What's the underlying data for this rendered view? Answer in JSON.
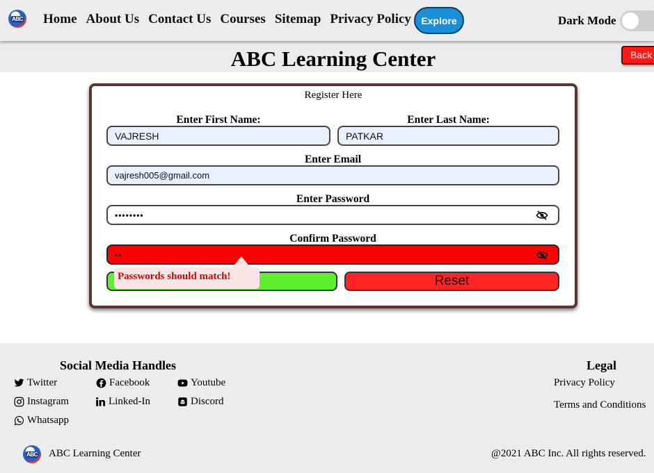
{
  "nav": {
    "logo_text": "ABC",
    "links": [
      "Home",
      "About Us",
      "Contact Us",
      "Courses",
      "Sitemap",
      "Privacy Policy"
    ],
    "explore_label": "Explore",
    "dark_mode_label": "Dark Mode",
    "dark_mode_on": false
  },
  "header": {
    "title": "ABC Learning Center",
    "back_label": "Back"
  },
  "form": {
    "title": "Register Here",
    "first_name_label": "Enter First Name:",
    "first_name_value": "VAJRESH",
    "last_name_label": "Enter Last Name:",
    "last_name_value": "PATKAR",
    "email_label": "Enter Email",
    "email_value": "vajresh005@gmail.com",
    "password_label": "Enter Password",
    "password_masked": "••••••••",
    "confirm_label": "Confirm Password",
    "confirm_masked": "••",
    "error_message": "Passwords should match!",
    "reset_label": "Reset"
  },
  "footer": {
    "social_heading": "Social Media Handles",
    "social": [
      "Twitter",
      "Facebook",
      "Youtube",
      "Instagram",
      "Linked-In",
      "Discord",
      "Whatsapp"
    ],
    "legal_heading": "Legal",
    "legal": [
      "Privacy Policy",
      "Terms and Conditions"
    ],
    "brand_logo_text": "ABC",
    "brand_name": "ABC Learning Center",
    "copyright": "@2021 ABC Inc. All rights reserved."
  },
  "colors": {
    "accent_blue": "#1a8fd6",
    "error_red": "#ff0000",
    "submit_green": "#5ef02f",
    "reset_red": "#ff2424"
  }
}
